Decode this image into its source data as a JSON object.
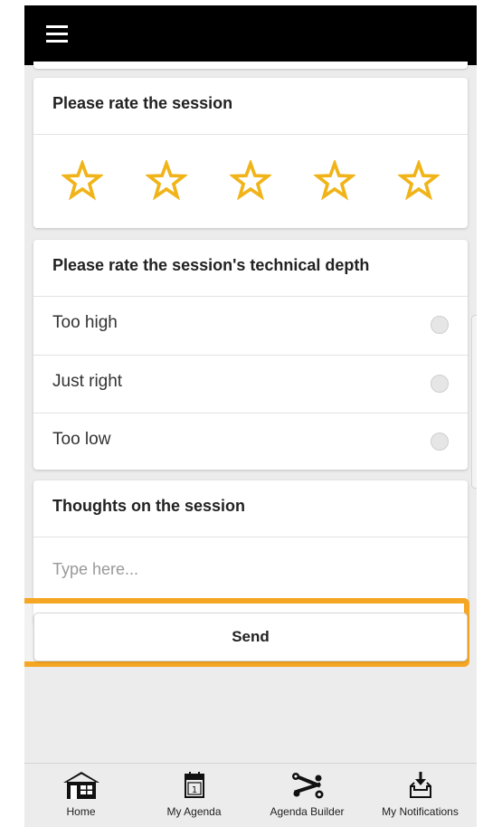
{
  "colors": {
    "accent": "#f5a623",
    "star": "#f0b419",
    "topbar": "#000000",
    "background": "#ececec"
  },
  "header": {
    "menu_icon": "hamburger-icon"
  },
  "rating": {
    "title": "Please rate the session",
    "star_icon": "star-outline-icon",
    "max_stars": 5,
    "selected": 0
  },
  "depth": {
    "title": "Please rate the session's technical depth",
    "options": [
      {
        "label": "Too high",
        "selected": false
      },
      {
        "label": "Just right",
        "selected": false
      },
      {
        "label": "Too low",
        "selected": false
      }
    ]
  },
  "thoughts": {
    "title": "Thoughts on the session",
    "value": "",
    "placeholder": "Type here..."
  },
  "send": {
    "label": "Send"
  },
  "nav": {
    "items": [
      {
        "label": "Home",
        "icon": "home-icon"
      },
      {
        "label": "My Agenda",
        "icon": "calendar-icon"
      },
      {
        "label": "Agenda Builder",
        "icon": "tools-icon"
      },
      {
        "label": "My Notifications",
        "icon": "inbox-download-icon"
      }
    ]
  }
}
